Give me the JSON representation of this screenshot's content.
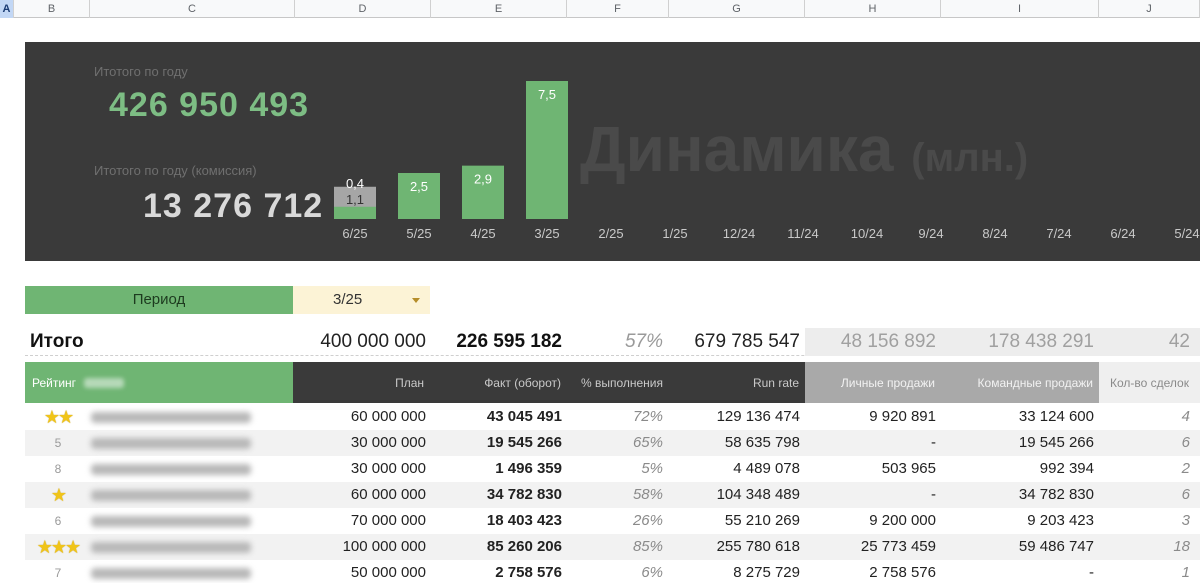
{
  "columns": [
    "A",
    "B",
    "C",
    "D",
    "E",
    "F",
    "G",
    "H",
    "I",
    "J"
  ],
  "banner": {
    "year_total_label": "Итотого по году",
    "year_total_value": "426 950 493",
    "commission_label": "Итотого по году (комиссия)",
    "commission_value": "13 276 712",
    "watermark_title": "Динамика",
    "watermark_unit": "(млн.)"
  },
  "chart_data": {
    "type": "bar",
    "categories": [
      "6/25",
      "5/25",
      "4/25",
      "3/25",
      "2/25",
      "1/25",
      "12/24",
      "11/24",
      "10/24",
      "9/24",
      "8/24",
      "7/24",
      "6/24",
      "5/24"
    ],
    "series": [
      {
        "values": [
          1.1,
          2.5,
          2.9,
          7.5,
          null,
          null,
          null,
          null,
          null,
          null,
          null,
          null,
          null,
          null
        ],
        "color": "#6fb573"
      },
      {
        "values": [
          0.4,
          null,
          null,
          null,
          null,
          null,
          null,
          null,
          null,
          null,
          null,
          null,
          null,
          null
        ],
        "color": "#a6a6a6"
      }
    ],
    "data_labels": [
      "1,1",
      "2,5",
      "2,9",
      "7,5"
    ],
    "extra_label": "0,4",
    "ylim": [
      0,
      7.5
    ]
  },
  "period": {
    "label": "Период",
    "value": "3/25"
  },
  "totals": {
    "label": "Итого",
    "plan": "400 000 000",
    "fact": "226 595 182",
    "pct": "57%",
    "run_rate": "679 785 547",
    "personal": "48 156 892",
    "team": "178 438 291",
    "deals": "42"
  },
  "headers": {
    "rating": "Рейтинг",
    "plan": "План",
    "fact": "Факт (оборот)",
    "pct": "% выполнения",
    "run_rate": "Run rate",
    "personal": "Личные продажи",
    "team": "Командные продажи",
    "deals": "Кол-во сделок"
  },
  "rows": [
    {
      "rank": "★★",
      "plan": "60 000 000",
      "fact": "43 045 491",
      "pct": "72%",
      "run_rate": "129 136 474",
      "personal": "9 920 891",
      "team": "33 124 600",
      "deals": "4"
    },
    {
      "rank": "5",
      "plan": "30 000 000",
      "fact": "19 545 266",
      "pct": "65%",
      "run_rate": "58 635 798",
      "personal": "-",
      "team": "19 545 266",
      "deals": "6"
    },
    {
      "rank": "8",
      "plan": "30 000 000",
      "fact": "1 496 359",
      "pct": "5%",
      "run_rate": "4 489 078",
      "personal": "503 965",
      "team": "992 394",
      "deals": "2"
    },
    {
      "rank": "★",
      "plan": "60 000 000",
      "fact": "34 782 830",
      "pct": "58%",
      "run_rate": "104 348 489",
      "personal": "-",
      "team": "34 782 830",
      "deals": "6"
    },
    {
      "rank": "6",
      "plan": "70 000 000",
      "fact": "18 403 423",
      "pct": "26%",
      "run_rate": "55 210 269",
      "personal": "9 200 000",
      "team": "9 203 423",
      "deals": "3"
    },
    {
      "rank": "★★★",
      "plan": "100 000 000",
      "fact": "85 260 206",
      "pct": "85%",
      "run_rate": "255 780 618",
      "personal": "25 773 459",
      "team": "59 486 747",
      "deals": "18"
    },
    {
      "rank": "7",
      "plan": "50 000 000",
      "fact": "2 758 576",
      "pct": "6%",
      "run_rate": "8 275 729",
      "personal": "2 758 576",
      "team": "-",
      "deals": "1"
    }
  ]
}
